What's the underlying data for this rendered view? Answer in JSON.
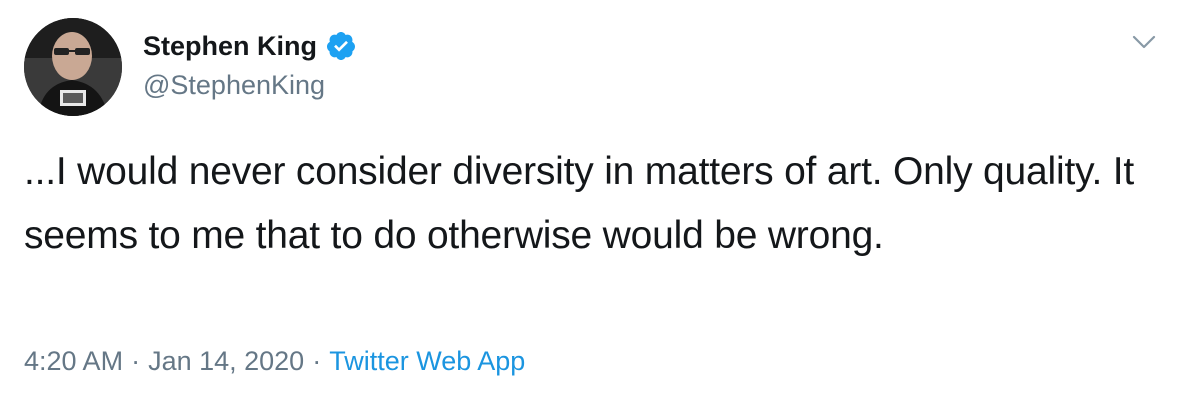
{
  "author": {
    "name": "Stephen King",
    "handle": "@StephenKing",
    "verified": true
  },
  "tweet": {
    "text": "...I would never consider diversity in matters of art. Only quality. It seems to me that to do otherwise would be wrong.",
    "time": "4:20 AM",
    "date": "Jan 14, 2020",
    "separator": "·",
    "source": "Twitter Web App"
  },
  "icons": {
    "verified": "verified-badge-icon",
    "menu": "chevron-down-icon"
  },
  "colors": {
    "text": "#14171a",
    "secondary": "#657786",
    "link": "#1b95e0",
    "verified": "#1da1f2"
  }
}
